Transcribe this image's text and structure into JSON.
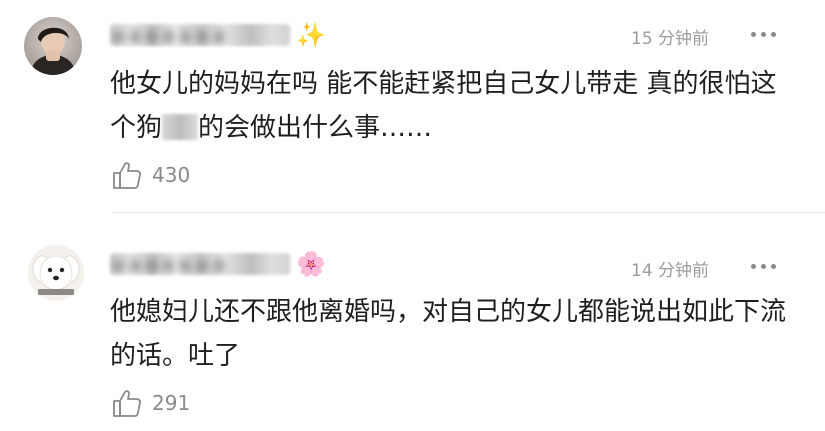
{
  "comments": [
    {
      "avatar": "person-avatar",
      "username_obscured": "※※※※※※※",
      "badge_icon": "sparkle-emoji",
      "badge_glyph": "✨",
      "time": "15 分钟前",
      "text_before": "他女儿的妈妈在吗 能不能赶紧把自己女儿带走 真的很怕这个狗",
      "text_after": "的会做出什么事……",
      "likes": "430"
    },
    {
      "avatar": "dog-avatar",
      "username_obscured": "※※※※※※※",
      "badge_icon": "cherry-blossom-emoji",
      "badge_glyph": "🌸",
      "time": "14 分钟前",
      "text": "他媳妇儿还不跟他离婚吗，对自己的女儿都能说出如此下流的话。吐了",
      "likes": "291"
    }
  ],
  "colors": {
    "text": "#1f1f1f",
    "meta": "#9b9b9b",
    "divider": "#e6e6e6"
  }
}
